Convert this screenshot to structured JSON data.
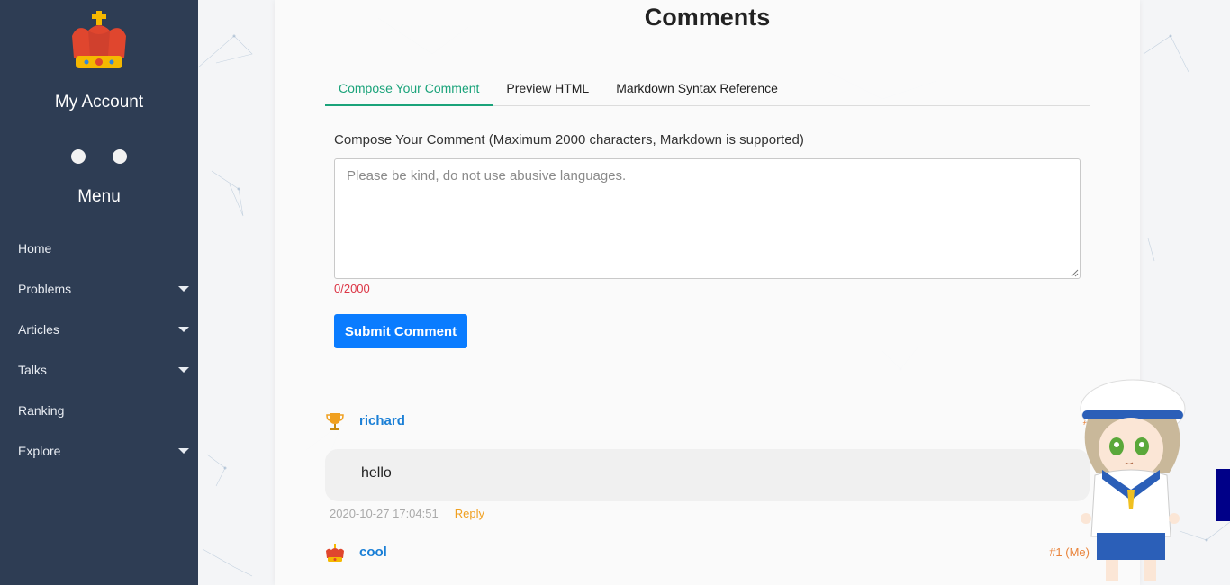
{
  "sidebar": {
    "account_title": "My Account",
    "menu_title": "Menu",
    "items": [
      {
        "label": "Home",
        "has_submenu": false
      },
      {
        "label": "Problems",
        "has_submenu": true
      },
      {
        "label": "Articles",
        "has_submenu": true
      },
      {
        "label": "Talks",
        "has_submenu": true
      },
      {
        "label": "Ranking",
        "has_submenu": false
      },
      {
        "label": "Explore",
        "has_submenu": true
      }
    ]
  },
  "main": {
    "title": "Comments",
    "tabs": [
      {
        "label": "Compose Your Comment",
        "active": true
      },
      {
        "label": "Preview HTML",
        "active": false
      },
      {
        "label": "Markdown Syntax Reference",
        "active": false
      }
    ],
    "compose": {
      "label": "Compose Your Comment (Maximum 2000 characters, Markdown is supported)",
      "placeholder": "Please be kind, do not use abusive languages.",
      "value": "",
      "char_count": "0/2000",
      "submit_label": "Submit Comment"
    },
    "comments": [
      {
        "user": "richard",
        "avatar_icon": "trophy-icon",
        "floor": "#",
        "text": "hello",
        "time": "2020-10-27 17:04:51",
        "reply_label": "Reply"
      },
      {
        "user": "cool",
        "avatar_icon": "crown-icon",
        "floor": "#1  (Me)"
      }
    ]
  },
  "colors": {
    "sidebar_bg": "#2e3d54",
    "accent_green": "#1aa37a",
    "primary_blue": "#0a7cff",
    "error_red": "#dc3545",
    "username_blue": "#1a7fd6",
    "floor_orange": "#e9833a",
    "reply_orange": "#f0a020"
  }
}
